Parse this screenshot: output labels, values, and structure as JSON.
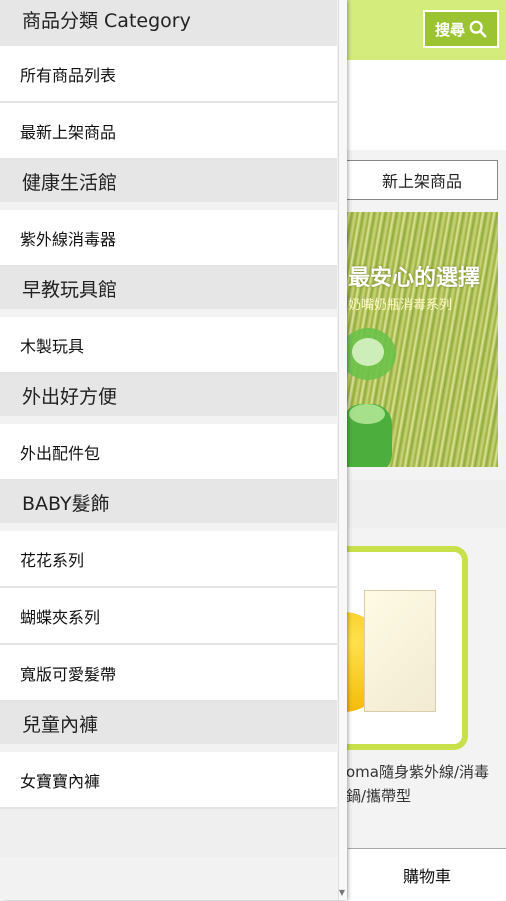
{
  "header": {
    "search_label": "搜尋"
  },
  "background": {
    "tab_new_items": "新上架商品",
    "banner_title": "最安心的選擇",
    "banner_subtitle": "奶嘴奶瓶消毒系列",
    "product_name": "oma隨身紫外線/消毒鍋/攜帶型",
    "cart_label": "購物車"
  },
  "drawer": {
    "title": "商品分類 Category",
    "top_items": [
      "所有商品列表",
      "最新上架商品"
    ],
    "sections": [
      {
        "label": "健康生活館",
        "items": [
          "紫外線消毒器"
        ]
      },
      {
        "label": "早教玩具館",
        "items": [
          "木製玩具"
        ]
      },
      {
        "label": "外出好方便",
        "items": [
          "外出配件包"
        ]
      },
      {
        "label": "BABY髮飾",
        "items": [
          "花花系列",
          "蝴蝶夾系列",
          "寬版可愛髮帶"
        ]
      },
      {
        "label": "兒童內褲",
        "items": [
          "女寶寶內褲"
        ]
      }
    ]
  },
  "colors": {
    "accent_green": "#9cc432",
    "header_green": "#d4ec7c",
    "card_border": "#c8e14a"
  }
}
